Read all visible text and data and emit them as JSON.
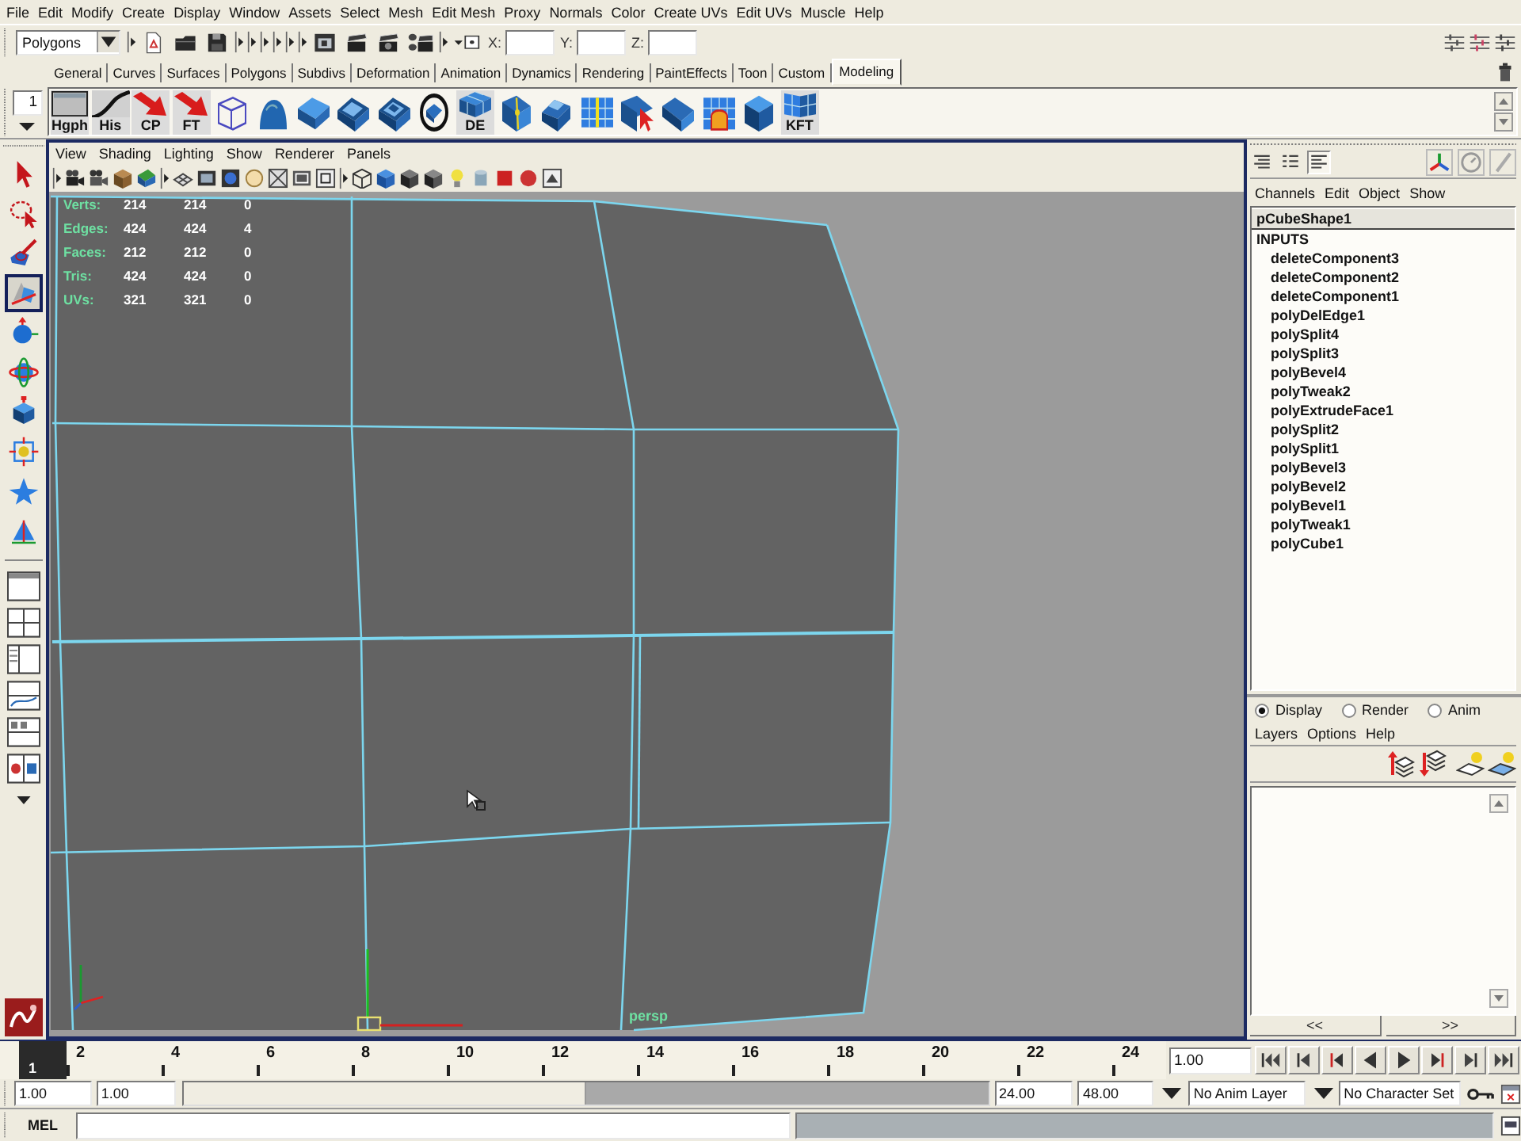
{
  "menu_bar": [
    "File",
    "Edit",
    "Modify",
    "Create",
    "Display",
    "Window",
    "Assets",
    "Select",
    "Mesh",
    "Edit Mesh",
    "Proxy",
    "Normals",
    "Color",
    "Create UVs",
    "Edit UVs",
    "Muscle",
    "Help"
  ],
  "status_line": {
    "mode": "Polygons",
    "coordinate_labels": [
      "X:",
      "Y:",
      "Z:"
    ]
  },
  "shelf_tabs": [
    {
      "label": "General",
      "selected": false
    },
    {
      "label": "Curves",
      "selected": false
    },
    {
      "label": "Surfaces",
      "selected": false
    },
    {
      "label": "Polygons",
      "selected": false
    },
    {
      "label": "Subdivs",
      "selected": false
    },
    {
      "label": "Deformation",
      "selected": false
    },
    {
      "label": "Animation",
      "selected": false
    },
    {
      "label": "Dynamics",
      "selected": false
    },
    {
      "label": "Rendering",
      "selected": false
    },
    {
      "label": "PaintEffects",
      "selected": false
    },
    {
      "label": "Toon",
      "selected": false
    },
    {
      "label": "Custom",
      "selected": false
    },
    {
      "label": "Modeling",
      "selected": true
    }
  ],
  "shelf": {
    "index": "1",
    "labels": [
      "Hgph",
      "His",
      "CP",
      "FT",
      "DE",
      "KFT"
    ]
  },
  "toolbox": {
    "tools": [
      {
        "selected": false
      },
      {
        "selected": false
      },
      {
        "selected": false
      },
      {
        "selected": true
      },
      {
        "selected": false
      },
      {
        "selected": false
      },
      {
        "selected": false
      },
      {
        "selected": false
      },
      {
        "selected": false
      },
      {
        "selected": false
      }
    ]
  },
  "viewport": {
    "menu": [
      "View",
      "Shading",
      "Lighting",
      "Show",
      "Renderer",
      "Panels"
    ],
    "hud": [
      {
        "label": "Verts:",
        "values": [
          "214",
          "214",
          "0"
        ]
      },
      {
        "label": "Edges:",
        "values": [
          "424",
          "424",
          "4"
        ]
      },
      {
        "label": "Faces:",
        "values": [
          "212",
          "212",
          "0"
        ]
      },
      {
        "label": "Tris:",
        "values": [
          "424",
          "424",
          "0"
        ]
      },
      {
        "label": "UVs:",
        "values": [
          "321",
          "321",
          "0"
        ]
      }
    ],
    "camera": "persp"
  },
  "channel_box": {
    "view_buttons": [
      {
        "selected": false
      },
      {
        "selected": false
      },
      {
        "selected": true
      }
    ],
    "menu": [
      "Channels",
      "Edit",
      "Object",
      "Show"
    ],
    "object": "pCubeShape1",
    "section": "INPUTS",
    "inputs": [
      "deleteComponent3",
      "deleteComponent2",
      "deleteComponent1",
      "polyDelEdge1",
      "polySplit4",
      "polySplit3",
      "polyBevel4",
      "polyTweak2",
      "polyExtrudeFace1",
      "polySplit2",
      "polySplit1",
      "polyBevel3",
      "polyBevel2",
      "polyBevel1",
      "polyTweak1",
      "polyCube1"
    ]
  },
  "layer_editor": {
    "modes": [
      {
        "label": "Display",
        "selected": true
      },
      {
        "label": "Render",
        "selected": false
      },
      {
        "label": "Anim",
        "selected": false
      }
    ],
    "menu": [
      "Layers",
      "Options",
      "Help"
    ],
    "scroll_buttons": [
      "<<",
      ">>"
    ]
  },
  "time_slider": {
    "current_frame": "1",
    "level": 0,
    "ticks": [
      "2",
      "4",
      "6",
      "8",
      "10",
      "12",
      "14",
      "16",
      "18",
      "20",
      "22",
      "24"
    ],
    "current_time": "1.00"
  },
  "range_slider": {
    "start": "1.00",
    "playback_start": "1.00",
    "level": 0.5,
    "playback_end": "24.00",
    "end": "48.00",
    "anim_layer": "No Anim Layer",
    "character_set": "No Character Set"
  },
  "command_line": {
    "language": "MEL"
  }
}
